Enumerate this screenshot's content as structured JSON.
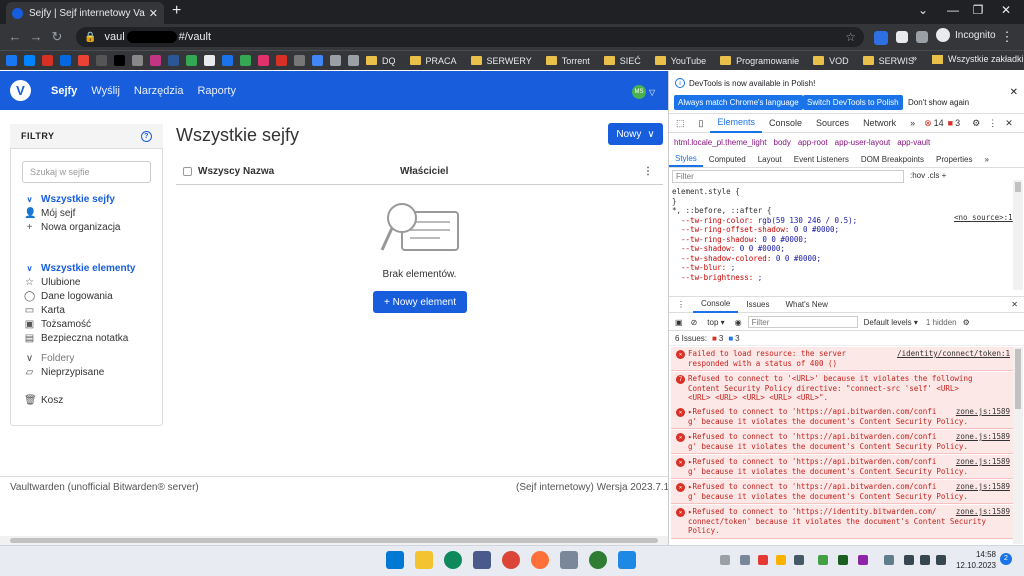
{
  "browser": {
    "tab_title": "Sejfy | Sejf internetowy Vaultwarden",
    "url_prefix": "vaul",
    "url_suffix": "#/vault",
    "profile": "Incognito",
    "bookmarks": [
      "DQ",
      "PRACA",
      "SERWERY",
      "Torrent",
      "SIEĆ",
      "YouTube",
      "Programowanie",
      "VOD",
      "SERWIS"
    ],
    "bookmarks_all": "Wszystkie zakładki"
  },
  "vault": {
    "nav": [
      "Sejfy",
      "Wyślij",
      "Narzędzia",
      "Raporty"
    ],
    "user_initials": "MS",
    "filters": {
      "title": "FILTRY",
      "search_placeholder": "Szukaj w sejfie",
      "vaults_header": "Wszystkie sejfy",
      "my_vault": "Mój sejf",
      "new_org": "Nowa organizacja",
      "items_header": "Wszystkie elementy",
      "favorites": "Ulubione",
      "login": "Dane logowania",
      "card": "Karta",
      "identity": "Tożsamość",
      "note": "Bezpieczna notatka",
      "folders": "Foldery",
      "unassigned": "Nieprzypisane",
      "trash": "Kosz"
    },
    "main_title": "Wszystkie sejfy",
    "new_button": "Nowy",
    "col_all": "Wszyscy",
    "col_name": "Nazwa",
    "col_owner": "Właściciel",
    "empty_text": "Brak elementów.",
    "new_item": "+ Nowy element",
    "footer_left": "Vaultwarden (unofficial Bitwarden® server)",
    "footer_right": "(Sejf internetowy) Wersja 2023.7.1"
  },
  "devtools": {
    "info": "DevTools is now available in Polish!",
    "btn_match": "Always match Chrome's language",
    "btn_switch": "Switch DevTools to Polish",
    "btn_dont": "Don't show again",
    "tabs": [
      "Elements",
      "Console",
      "Sources",
      "Network"
    ],
    "err_count": "14",
    "warn_count": "3",
    "crumbs": [
      "html.locale_pl.theme_light",
      "body",
      "app-root",
      "app-user-layout",
      "app-vault"
    ],
    "style_tabs": [
      "Styles",
      "Computed",
      "Layout",
      "Event Listeners",
      "DOM Breakpoints",
      "Properties"
    ],
    "filter_placeholder": "Filter",
    "filter_tools": ":hov  .cls  +",
    "source_link": "<no source>:1",
    "styles_lines": [
      [
        "element.style {",
        ""
      ],
      [
        "}",
        ""
      ],
      [
        "*, ::before, ::after {",
        ""
      ],
      [
        "  --tw-ring-color: ",
        "rgb(59 130 246 / 0.5);"
      ],
      [
        "  --tw-ring-offset-shadow: ",
        "0 0 #0000;"
      ],
      [
        "  --tw-ring-shadow: ",
        "0 0 #0000;"
      ],
      [
        "  --tw-shadow: ",
        "0 0 #0000;"
      ],
      [
        "  --tw-shadow-colored: ",
        "0 0 #0000;"
      ],
      [
        "  --tw-blur: ",
        ";"
      ],
      [
        "  --tw-brightness: ",
        ";"
      ]
    ],
    "drawer_tabs": [
      "Console",
      "Issues",
      "What's New"
    ],
    "context": "top",
    "console_filter": "Filter",
    "levels": "Default levels",
    "hidden": "1 hidden",
    "issues_label": "6 Issues:",
    "issues_err": "3",
    "issues_warn": "3",
    "errors": [
      {
        "text": "Failed to load resource: the server\nresponded with a status of 400 ()",
        "src": "/identity/connect/token:1",
        "badge": "✕"
      },
      {
        "text": "Refused to connect to '<URL>' because it violates the following\nContent Security Policy directive: \"connect-src 'self' <URL>\n<URL> <URL> <URL> <URL> <URL>\".",
        "src": "",
        "badge": "7"
      },
      {
        "text": "▸Refused to connect to 'https://api.bitwarden.com/confi\ng' because it violates the document's Content Security Policy.",
        "src": "zone.js:1589",
        "badge": "✕"
      },
      {
        "text": "▸Refused to connect to 'https://api.bitwarden.com/confi\ng' because it violates the document's Content Security Policy.",
        "src": "zone.js:1589",
        "badge": "✕"
      },
      {
        "text": "▸Refused to connect to 'https://api.bitwarden.com/confi\ng' because it violates the document's Content Security Policy.",
        "src": "zone.js:1589",
        "badge": "✕"
      },
      {
        "text": "▸Refused to connect to 'https://api.bitwarden.com/confi\ng' because it violates the document's Content Security Policy.",
        "src": "zone.js:1589",
        "badge": "✕"
      },
      {
        "text": "▸Refused to connect to 'https://identity.bitwarden.com/\nconnect/token' because it violates the document's Content Security\nPolicy.",
        "src": "zone.js:1589",
        "badge": "✕"
      }
    ]
  },
  "taskbar": {
    "time": "14:58",
    "date": "12.10.2023",
    "notif": "2"
  }
}
